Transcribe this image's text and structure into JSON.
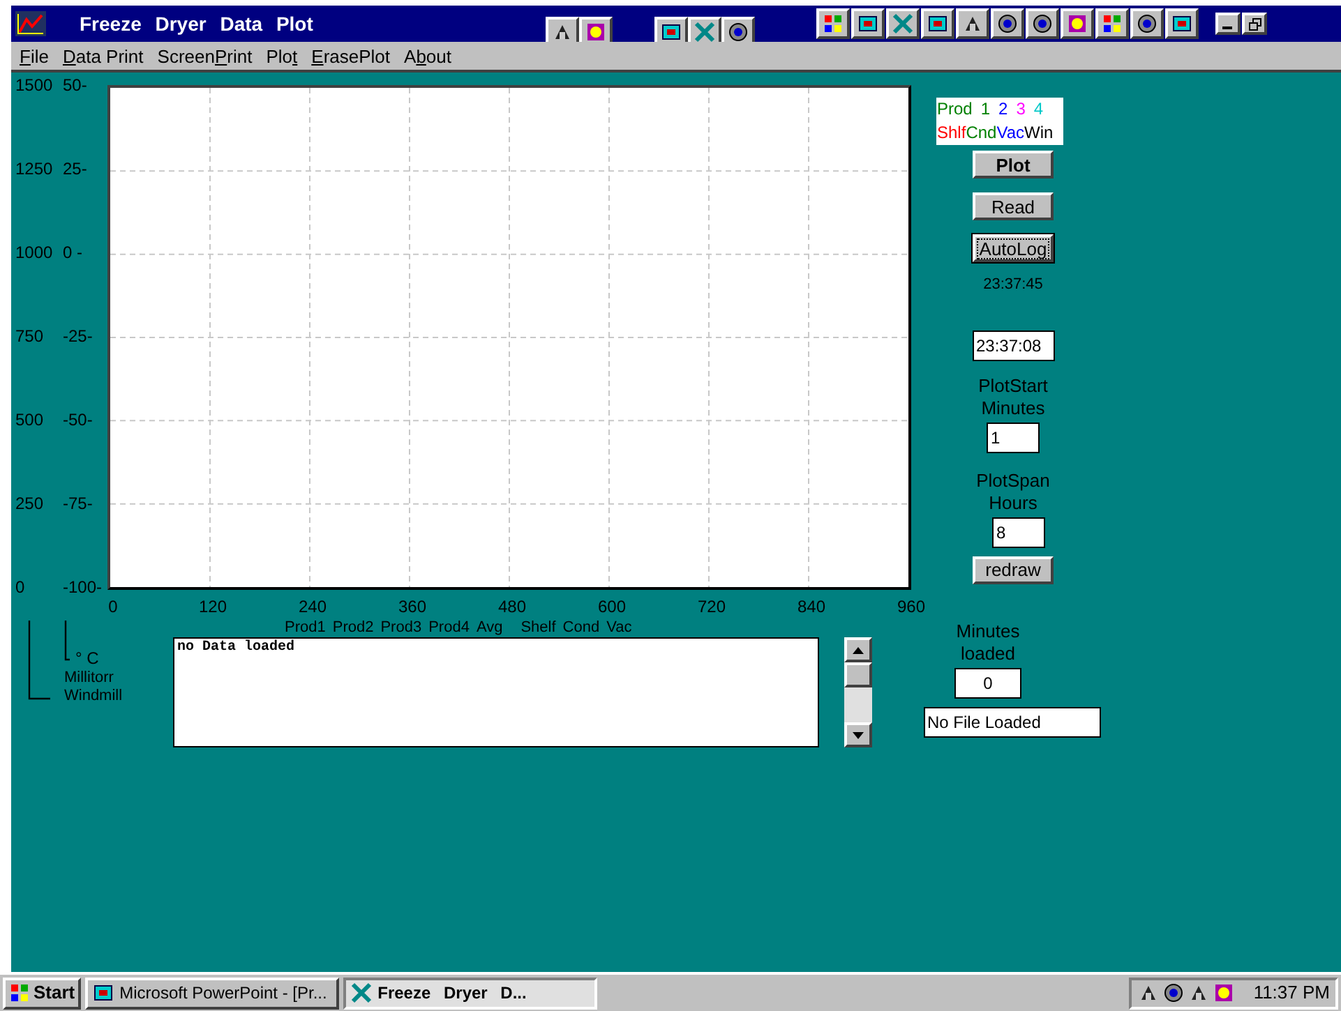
{
  "window": {
    "title": "Freeze Dryer Data Plot"
  },
  "menu": [
    {
      "key": "F",
      "post": "ile"
    },
    {
      "key": "D",
      "post": "ata Print"
    },
    {
      "pre": "Screen",
      "key": "P",
      "post": "rint"
    },
    {
      "pre": "Plo",
      "key": "t"
    },
    {
      "key": "E",
      "post": "rasePlot"
    },
    {
      "pre": "A",
      "key": "b",
      "post": "out"
    }
  ],
  "chart": {
    "y_ticks": [
      {
        "pressure": "1500",
        "temperature": "50-"
      },
      {
        "pressure": "1250",
        "temperature": "25-"
      },
      {
        "pressure": "1000",
        "temperature": "0 -"
      },
      {
        "pressure": "750",
        "temperature": "-25-"
      },
      {
        "pressure": "500",
        "temperature": "-50-"
      },
      {
        "pressure": "250",
        "temperature": "-75-"
      },
      {
        "pressure": "0",
        "temperature": "-100-"
      }
    ],
    "x_ticks": [
      "0",
      "120",
      "240",
      "360",
      "480",
      "600",
      "720",
      "840",
      "960"
    ]
  },
  "axis_legend": {
    "temperature": "° C",
    "pressure": "Millitorr",
    "wind": "Windmill"
  },
  "log": {
    "columns": [
      "Prod1",
      "Prod2",
      "Prod3",
      "Prod4",
      "Avg",
      "Shelf",
      "Cond",
      "Vac"
    ],
    "text": "no Data loaded"
  },
  "legend": [
    [
      {
        "text": "Prod",
        "color": "#008000"
      },
      {
        "text": "1",
        "color": "#008000"
      },
      {
        "text": "2",
        "color": "#0000ff"
      },
      {
        "text": "3",
        "color": "#ff00ff"
      },
      {
        "text": "4",
        "color": "#00c8c8"
      }
    ],
    [
      {
        "text": "Shlf",
        "color": "#ff0000"
      },
      {
        "text": "Cnd",
        "color": "#008000"
      },
      {
        "text": "Vac",
        "color": "#0000ff"
      },
      {
        "text": "Win",
        "color": "#000000"
      }
    ]
  ],
  "buttons": {
    "plot": "Plot",
    "read": "Read",
    "autolog": {
      "label": "AutoLog",
      "focused": true
    },
    "redraw": "redraw"
  },
  "clock": "23:37:45",
  "time_field": "23:37:08",
  "plot_start": {
    "label": [
      "PlotStart",
      "Minutes"
    ],
    "value": "1"
  },
  "plot_span": {
    "label": [
      "PlotSpan",
      "Hours"
    ],
    "value": "8"
  },
  "minutes_loaded": {
    "label": [
      "Minutes",
      "loaded"
    ],
    "value": "0"
  },
  "file_status": "No File Loaded",
  "taskbar": {
    "start": "Start",
    "tasks": [
      {
        "label": "Microsoft PowerPoint - [Pr...",
        "selected": false
      },
      {
        "label": "Freeze Dryer D...",
        "selected": true
      }
    ],
    "clock": "11:37 PM"
  }
}
